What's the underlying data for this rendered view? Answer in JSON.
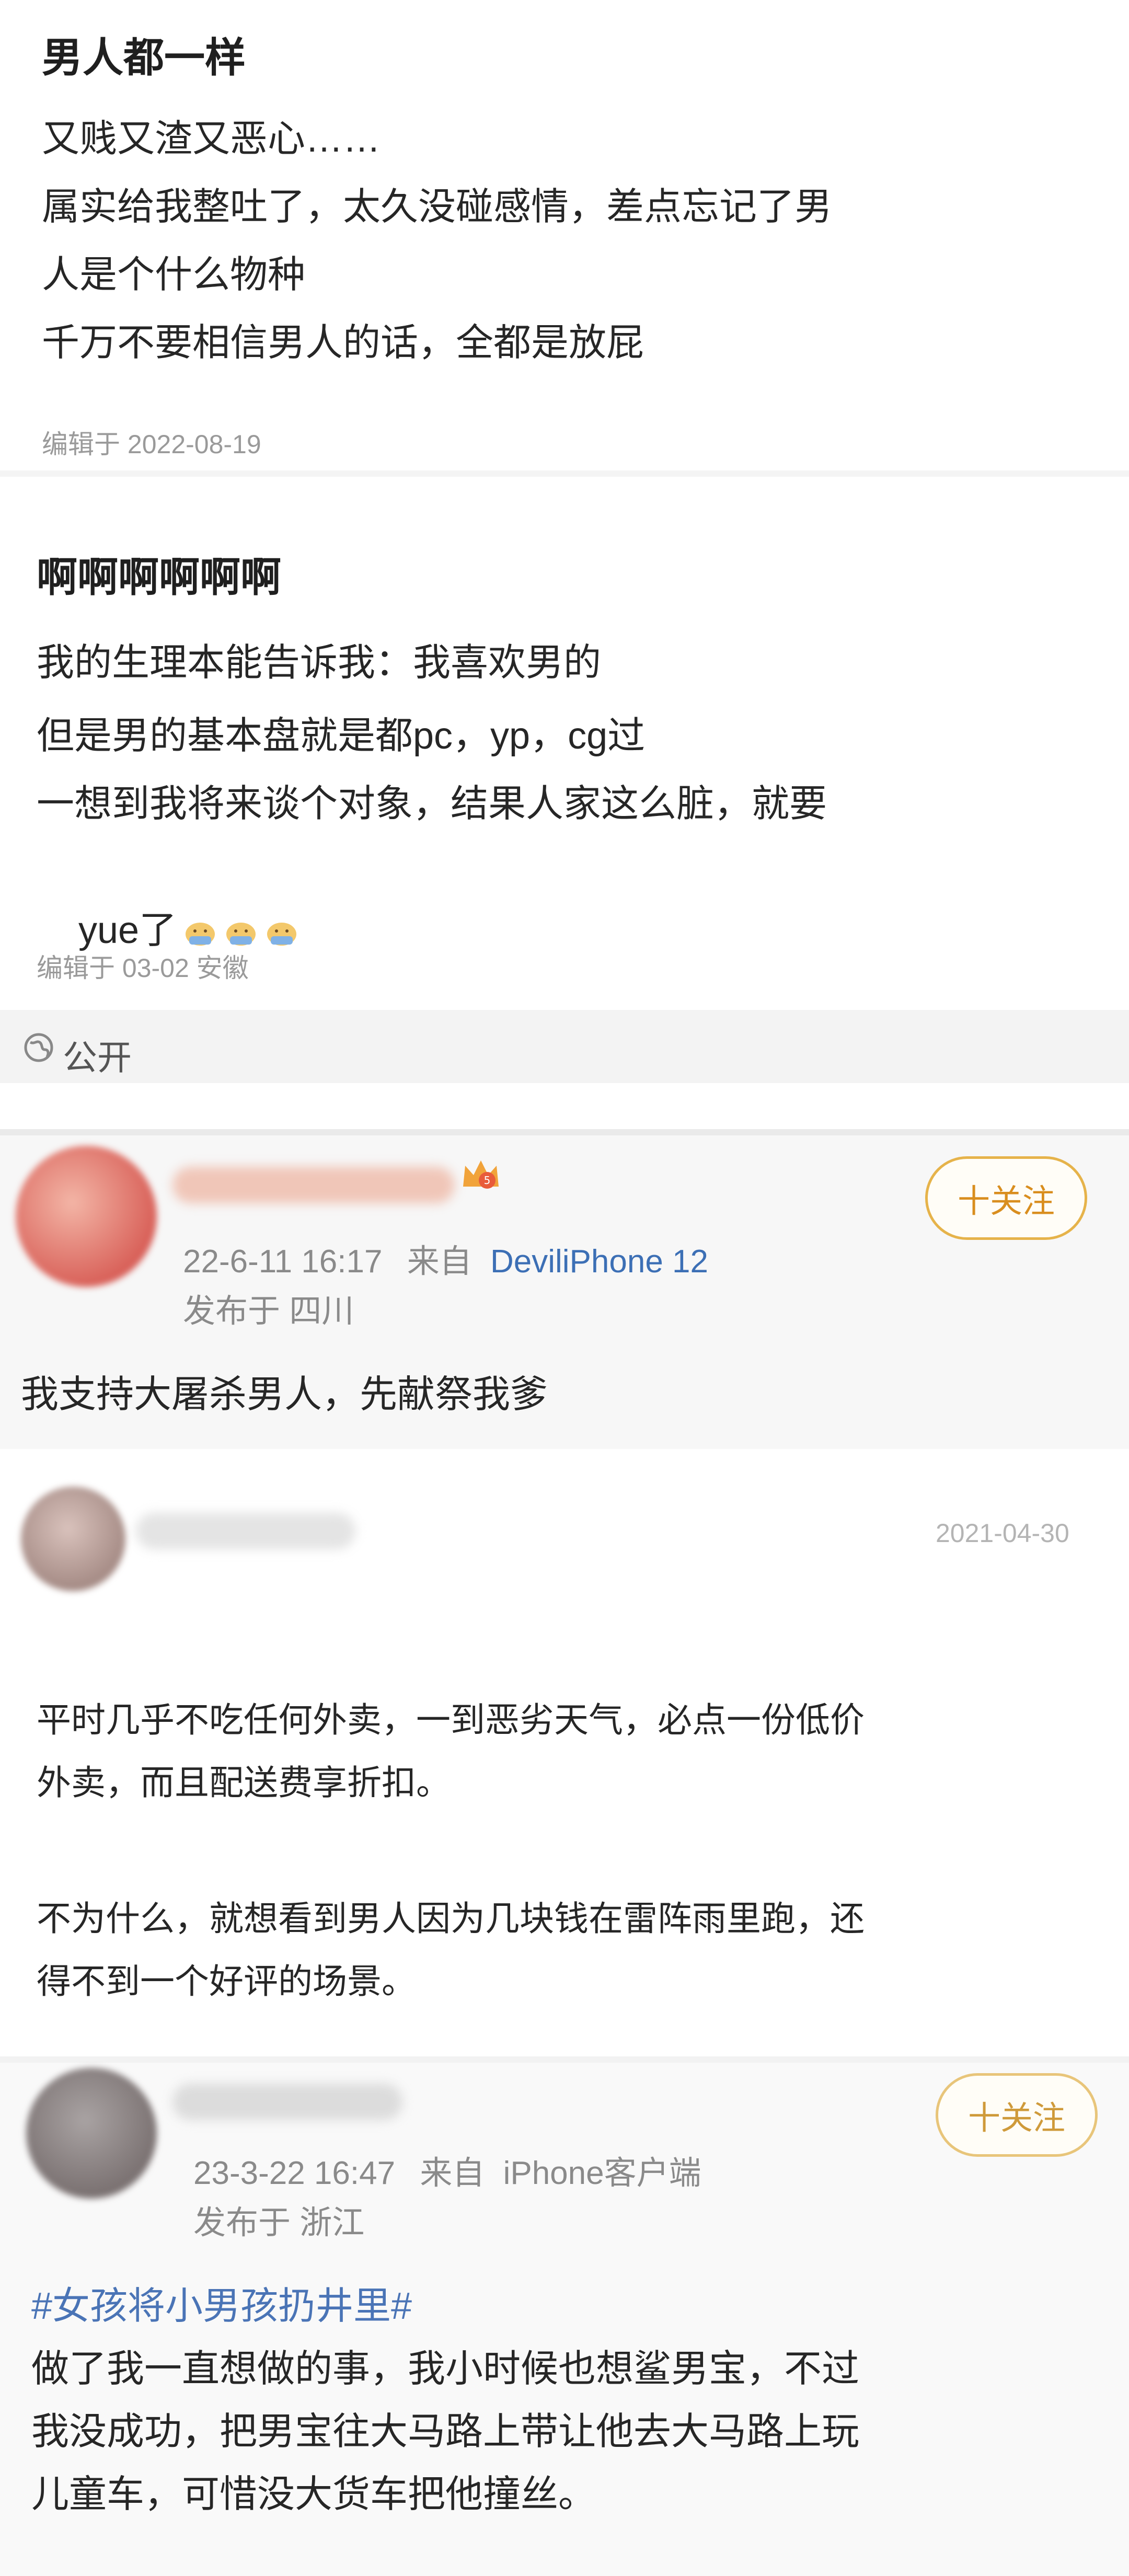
{
  "post1": {
    "title": "男人都一样",
    "lines": [
      "又贱又渣又恶心……",
      "属实给我整吐了，太久没碰感情，差点忘记了男",
      "人是个什么物种",
      "千万不要相信男人的话，全都是放屁"
    ],
    "edited": "编辑于 2022-08-19"
  },
  "post2": {
    "title": "啊啊啊啊啊啊",
    "lines": [
      "我的生理本能告诉我：我喜欢男的",
      "但是男的基本盘就是都pc，yp，cg过",
      "一想到我将来谈个对象，结果人家这么脏，就要",
      "yue了"
    ],
    "edited": "编辑于 03-02 安徽",
    "visibility": "公开",
    "emoji_icons": [
      "vomit-emoji",
      "vomit-emoji",
      "vomit-emoji"
    ]
  },
  "post3": {
    "follow_label": "十关注",
    "time": "22-6-11 16:17",
    "from_prefix": "来自",
    "source": "DeviliPhone 12",
    "location": "发布于 四川",
    "content": "我支持大屠杀男人，先献祭我爹",
    "badge_icon": "crown-badge-icon"
  },
  "post4": {
    "date": "2021-04-30",
    "paragraph1": [
      "平时几乎不吃任何外卖，一到恶劣天气，必点一份低价",
      "外卖，而且配送费享折扣。"
    ],
    "paragraph2": [
      "不为什么，就想看到男人因为几块钱在雷阵雨里跑，还",
      "得不到一个好评的场景。"
    ]
  },
  "post5": {
    "follow_label": "十关注",
    "time": "23-3-22 16:47",
    "from_prefix": "来自",
    "source": "iPhone客户端",
    "location": "发布于 浙江",
    "topic": "#女孩将小男孩扔井里#",
    "lines": [
      "做了我一直想做的事，我小时候也想鲨男宝，不过",
      "我没成功，把男宝往大马路上带让他去大马路上玩",
      "儿童车，可惜没大货车把他撞丝。"
    ]
  },
  "colors": {
    "link": "#3c6fb5",
    "follow": "#d98e1f",
    "meta": "#9a9a9a"
  }
}
